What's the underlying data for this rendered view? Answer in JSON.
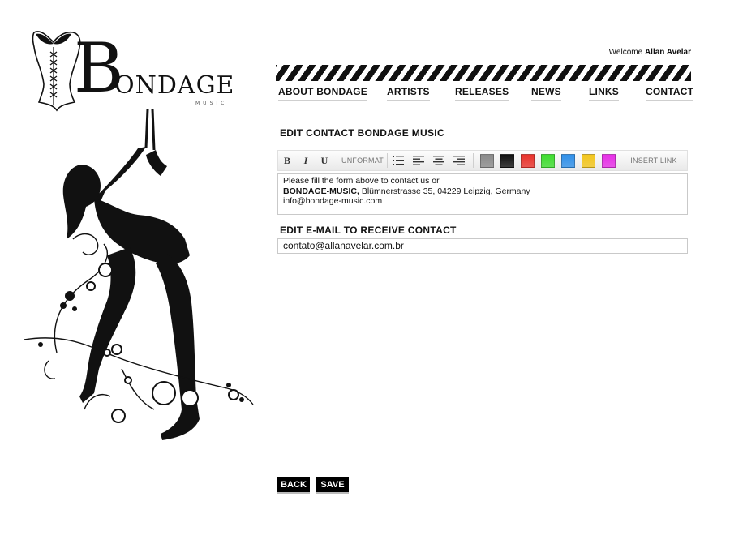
{
  "brand": {
    "logo_letter": "B",
    "logo_rest": "ONDAGE",
    "logo_sub": "MUSIC"
  },
  "welcome": {
    "prefix": "Welcome",
    "user": "Allan Avelar"
  },
  "nav": [
    {
      "label": "ABOUT BONDAGE"
    },
    {
      "label": "ARTISTS"
    },
    {
      "label": "RELEASES"
    },
    {
      "label": "NEWS"
    },
    {
      "label": "LINKS"
    },
    {
      "label": "CONTACT"
    }
  ],
  "contact_section": {
    "title": "EDIT CONTACT BONDAGE MUSIC"
  },
  "toolbar": {
    "bold": "B",
    "italic": "I",
    "underline": "U",
    "unformat": "UNFORMAT",
    "insert_link": "INSERT LINK",
    "colors": [
      "#8a8a8a",
      "#111111",
      "#e8312a",
      "#3ddc2e",
      "#2f8fe8",
      "#f2c51c",
      "#e62ee6"
    ]
  },
  "editor": {
    "line1": "Please fill the form above to contact us or",
    "line2_bold": "BONDAGE-MUSIC,",
    "line2_rest": " Blümnerstrasse 35, 04229 Leipzig, Germany",
    "line3": "info@bondage-music.com"
  },
  "email_section": {
    "title": "EDIT E-MAIL TO RECEIVE CONTACT",
    "value": "contato@allanavelar.com.br"
  },
  "buttons": {
    "back": "BACK",
    "save": "SAVE"
  }
}
